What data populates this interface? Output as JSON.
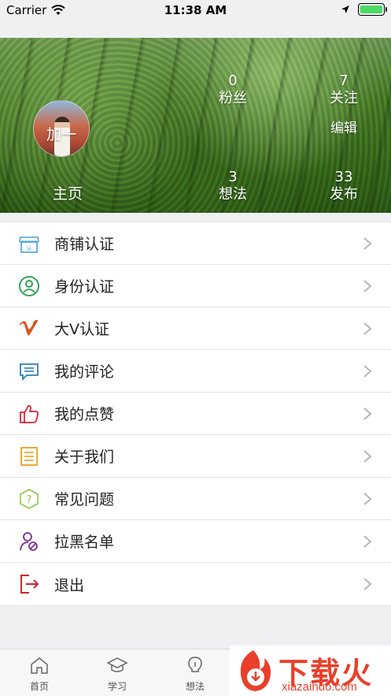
{
  "status_bar": {
    "carrier": "Carrier",
    "time": "11:38 AM"
  },
  "profile": {
    "name": "加一",
    "stats_top": [
      {
        "count": "0",
        "label": "粉丝"
      },
      {
        "count": "7",
        "label": "关注"
      }
    ],
    "edit_label": "编辑",
    "home_label": "主页",
    "stats_bottom": [
      {
        "count": "3",
        "label": "想法"
      },
      {
        "count": "33",
        "label": "发布"
      }
    ]
  },
  "menu": {
    "items": [
      {
        "label": "商铺认证",
        "icon": "shop-icon",
        "color": "#4aa3d9"
      },
      {
        "label": "身份认证",
        "icon": "person-icon",
        "color": "#1e9e4a"
      },
      {
        "label": "大V认证",
        "icon": "vimeo-v-icon",
        "color": "#d9541e"
      },
      {
        "label": "我的评论",
        "icon": "comment-icon",
        "color": "#2d7fb8"
      },
      {
        "label": "我的点赞",
        "icon": "thumbs-up-icon",
        "color": "#d6263b"
      },
      {
        "label": "关于我们",
        "icon": "document-icon",
        "color": "#f0a020"
      },
      {
        "label": "常见问题",
        "icon": "question-icon",
        "color": "#8cc63f"
      },
      {
        "label": "拉黑名单",
        "icon": "block-user-icon",
        "color": "#7b2f8f"
      },
      {
        "label": "退出",
        "icon": "logout-icon",
        "color": "#d0242f"
      }
    ]
  },
  "tabbar": {
    "tabs": [
      {
        "label": "首页",
        "icon": "home-icon"
      },
      {
        "label": "学习",
        "icon": "graduation-cap-icon"
      },
      {
        "label": "想法",
        "icon": "bulb-icon"
      }
    ]
  },
  "watermark": {
    "title": "下载火",
    "url": "xiazaihuo.com"
  }
}
